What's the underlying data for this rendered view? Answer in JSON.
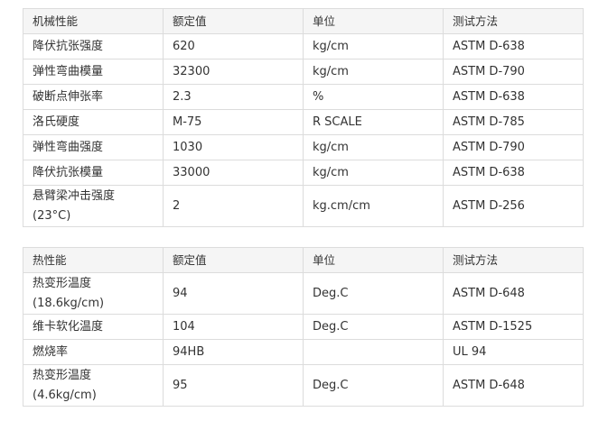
{
  "mechanical": {
    "headers": [
      "机械性能",
      "额定值",
      "单位",
      "测试方法"
    ],
    "rows": [
      [
        "降伏抗张强度",
        "620",
        "kg/cm",
        "ASTM D-638"
      ],
      [
        "弹性弯曲模量",
        "32300",
        "kg/cm",
        "ASTM D-790"
      ],
      [
        "破断点伸张率",
        "2.3",
        "%",
        "ASTM D-638"
      ],
      [
        "洛氏硬度",
        "M-75",
        "R SCALE",
        "ASTM D-785"
      ],
      [
        "弹性弯曲强度",
        "1030",
        "kg/cm",
        "ASTM D-790"
      ],
      [
        "降伏抗张模量",
        "33000",
        "kg/cm",
        "ASTM D-638"
      ],
      [
        "悬臂梁冲击强度\n(23°C)",
        "2",
        "kg.cm/cm",
        "ASTM D-256"
      ]
    ]
  },
  "thermal": {
    "headers": [
      "热性能",
      "额定值",
      "单位",
      "测试方法"
    ],
    "rows": [
      [
        "热变形温度\n(18.6kg/cm)",
        "94",
        "Deg.C",
        "ASTM D-648"
      ],
      [
        "维卡软化温度",
        "104",
        "Deg.C",
        "ASTM D-1525"
      ],
      [
        "燃烧率",
        "94HB",
        "",
        "UL 94"
      ],
      [
        "热变形温度\n(4.6kg/cm)",
        "95",
        "Deg.C",
        "ASTM D-648"
      ]
    ]
  }
}
